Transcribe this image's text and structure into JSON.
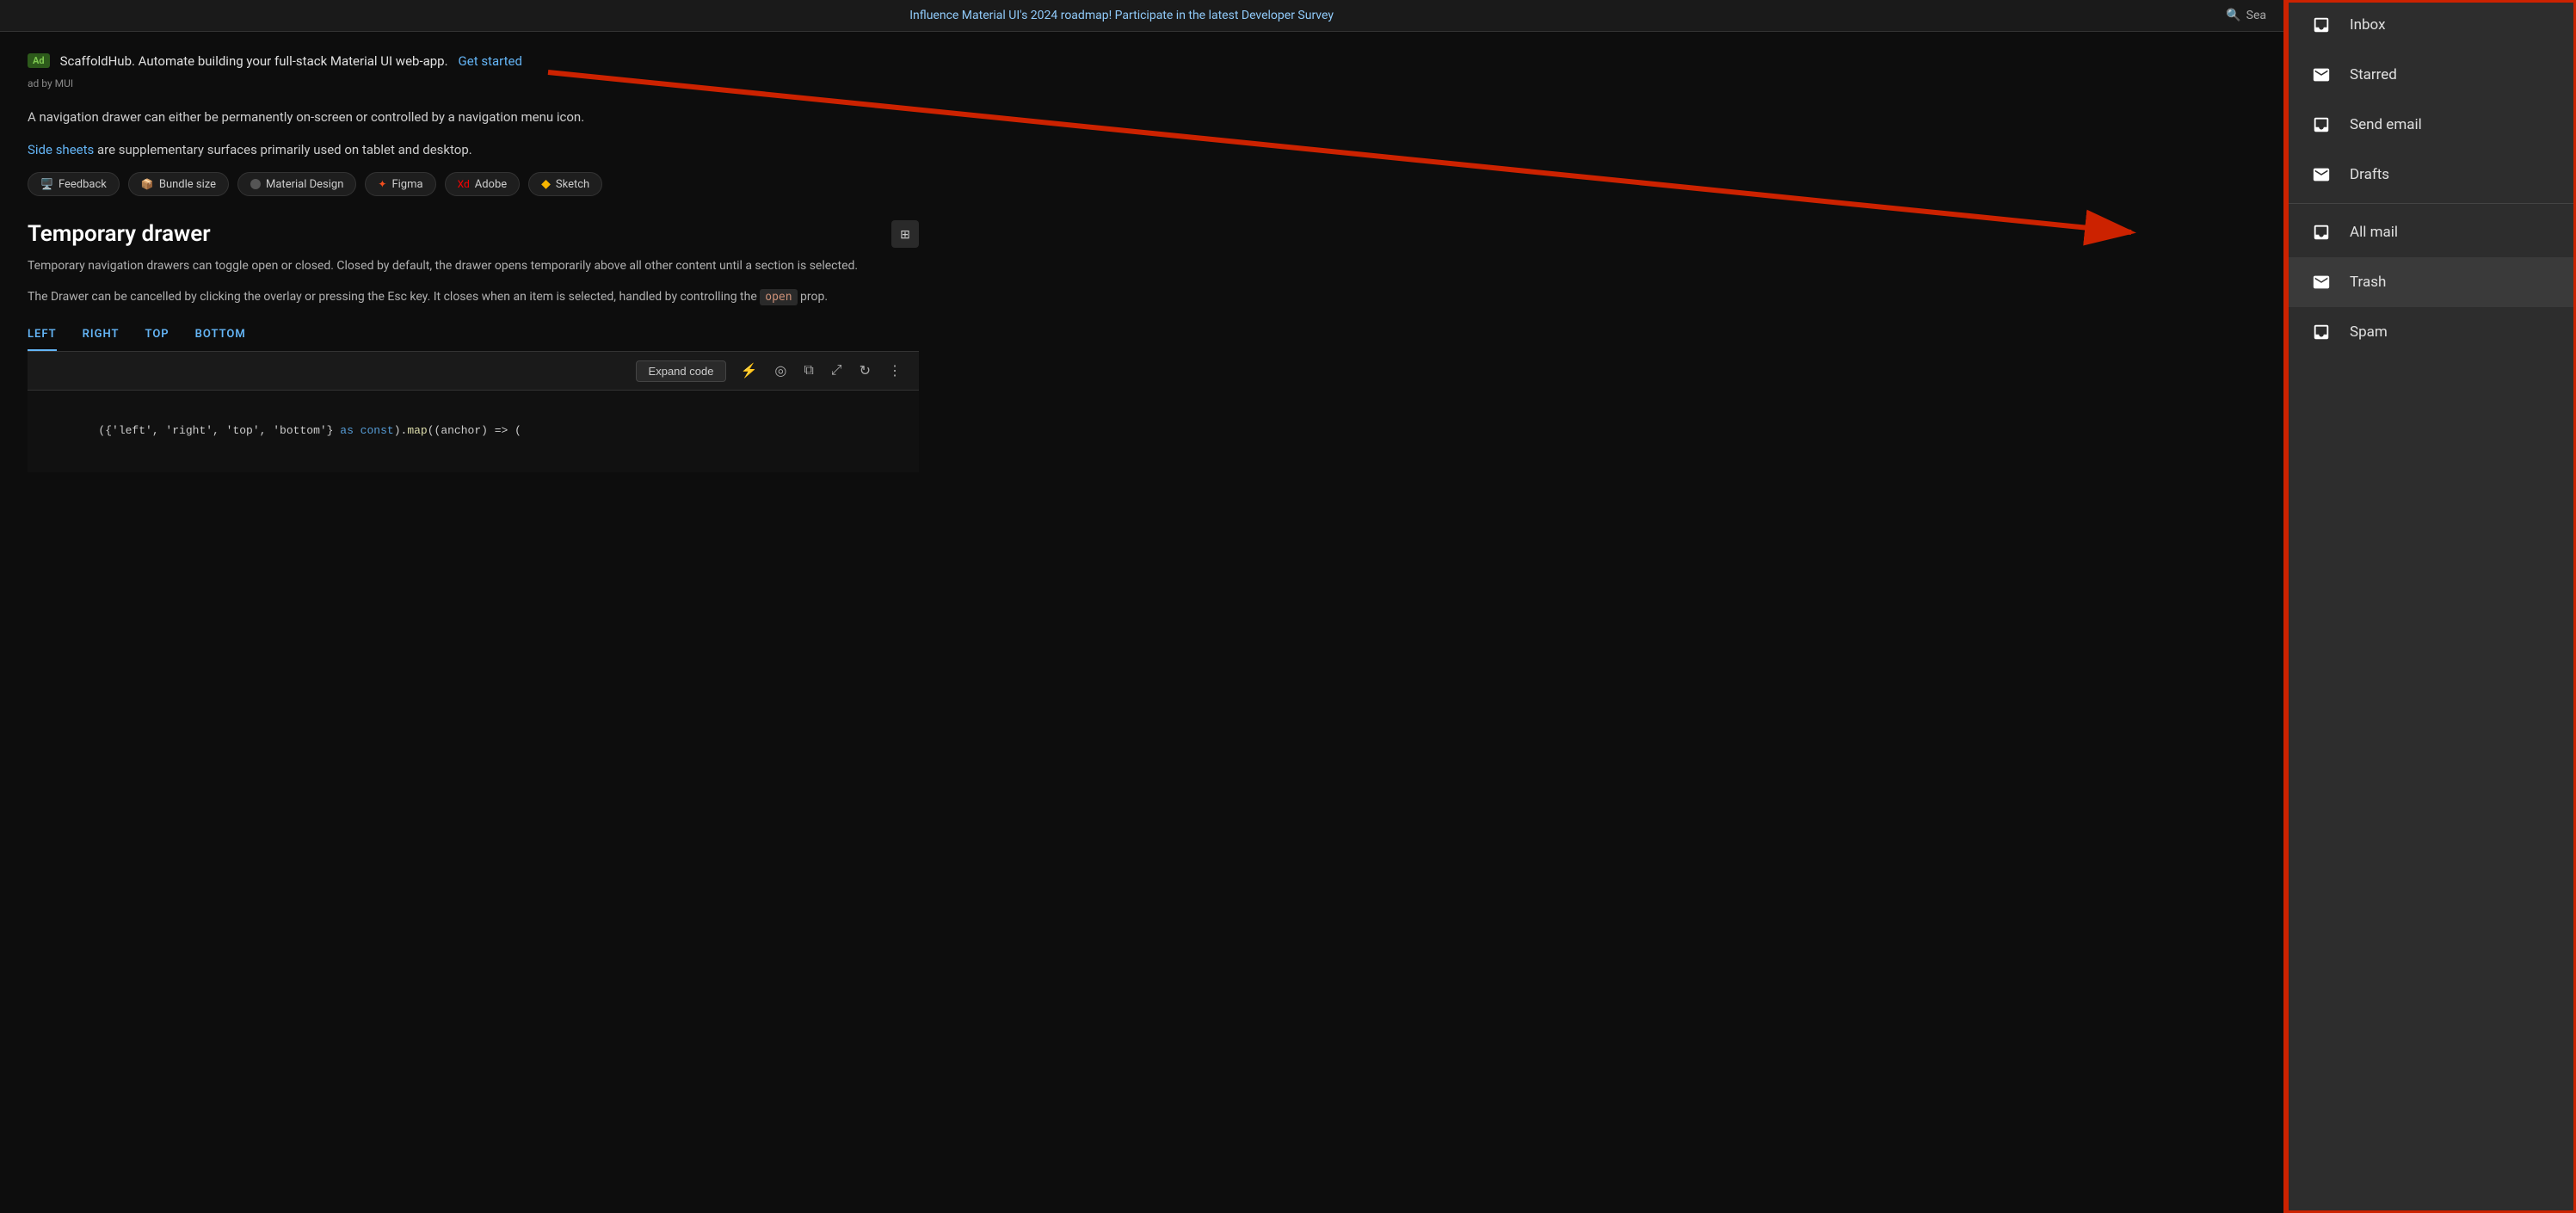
{
  "topbar": {
    "notice": "Influence Material UI's 2024 roadmap! Participate in the latest Developer Survey",
    "search_placeholder": "Sea"
  },
  "ad": {
    "badge": "Ad",
    "text": "ScaffoldHub. Automate building your full-stack Material UI web-app.",
    "link_text": "Get started",
    "by_text": "ad by MUI"
  },
  "body": {
    "para1": "A navigation drawer can either be permanently on-screen or controlled by a navigation menu icon.",
    "side_sheets_link": "Side sheets",
    "para2_rest": " are supplementary surfaces primarily used on tablet and desktop."
  },
  "tags": [
    {
      "label": "Feedback",
      "color": "#4fc3f7"
    },
    {
      "label": "Bundle size",
      "color": "#4fc3f7"
    },
    {
      "label": "Material Design",
      "color": "#555"
    },
    {
      "label": "Figma",
      "color": "#f24e1e"
    },
    {
      "label": "Adobe",
      "color": "#ff0000"
    },
    {
      "label": "Sketch",
      "color": "#f7b500"
    }
  ],
  "section": {
    "title": "Temporary drawer",
    "desc1": "Temporary navigation drawers can toggle open or closed. Closed by default, the drawer opens temporarily above all other content until a section is selected.",
    "desc2_pre": "The Drawer can be cancelled by clicking the overlay or pressing the Esc key. It closes when an item is selected, handled by controlling the ",
    "code_word": "open",
    "desc2_post": " prop."
  },
  "tabs": [
    {
      "label": "LEFT",
      "active": true
    },
    {
      "label": "RIGHT",
      "active": false
    },
    {
      "label": "TOP",
      "active": false
    },
    {
      "label": "BOTTOM",
      "active": false
    }
  ],
  "toolbar": {
    "expand_code": "Expand code"
  },
  "code": {
    "line1": "(['left', 'right', 'top', 'bottom'] as const).map((anchor) => ("
  },
  "drawer": {
    "items": [
      {
        "label": "Inbox",
        "icon": "inbox"
      },
      {
        "label": "Starred",
        "icon": "star"
      },
      {
        "label": "Send email",
        "icon": "send"
      },
      {
        "label": "Drafts",
        "icon": "drafts"
      },
      {
        "label": "All mail",
        "icon": "allmail"
      },
      {
        "label": "Trash",
        "icon": "trash"
      },
      {
        "label": "Spam",
        "icon": "spam"
      }
    ]
  }
}
